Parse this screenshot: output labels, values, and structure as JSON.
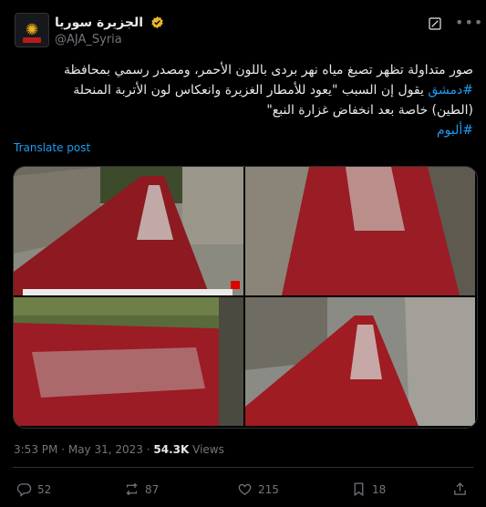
{
  "tweet": {
    "display_name": "الجزيرة سوريا",
    "handle": "@AJA_Syria",
    "text_line1": "صور متداولة تظهر تصبغ مياه نهر بردى باللون الأحمر، ومصدر رسمي بمحافظة",
    "hashtag_damascus": "#دمشق",
    "text_line2": " يقول إن السبب \"يعود للأمطار الغزيرة وانعكاس لون الأتربة المنحلة",
    "text_line3": "(الطين) خاصة بعد انخفاض غزارة النبع\"",
    "hashtag_album": "#ألبوم",
    "translate_label": "Translate post",
    "time": "3:53 PM",
    "separator": "·",
    "date": "May 31, 2023",
    "views_count": "54.3K",
    "views_label": "Views"
  },
  "actions": {
    "replies": "52",
    "reposts": "87",
    "likes": "215",
    "bookmarks": "18"
  },
  "icons": [
    "verified-badge-icon",
    "grok-icon",
    "more-icon",
    "reply-icon",
    "repost-icon",
    "like-icon",
    "bookmark-icon",
    "share-icon"
  ],
  "colors": {
    "accent": "#1d9bf0",
    "verified": "#e8b829",
    "muted": "#71767b"
  }
}
